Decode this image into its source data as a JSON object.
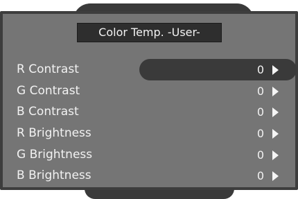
{
  "title": "Color Temp. -User-",
  "rows": [
    {
      "label": "R Contrast",
      "value": "0"
    },
    {
      "label": "G Contrast",
      "value": "0"
    },
    {
      "label": "B Contrast",
      "value": "0"
    },
    {
      "label": "R Brightness",
      "value": "0"
    },
    {
      "label": "G Brightness",
      "value": "0"
    },
    {
      "label": "B Brightness",
      "value": "0"
    }
  ],
  "selected_row": "R Contrast",
  "colors": {
    "panel": "#757575",
    "frame": "#3d3d3d",
    "highlight": "#3a3a3a",
    "text": "#f2f2f2"
  },
  "icons": {
    "row_arrow": "triangle-right-icon"
  }
}
